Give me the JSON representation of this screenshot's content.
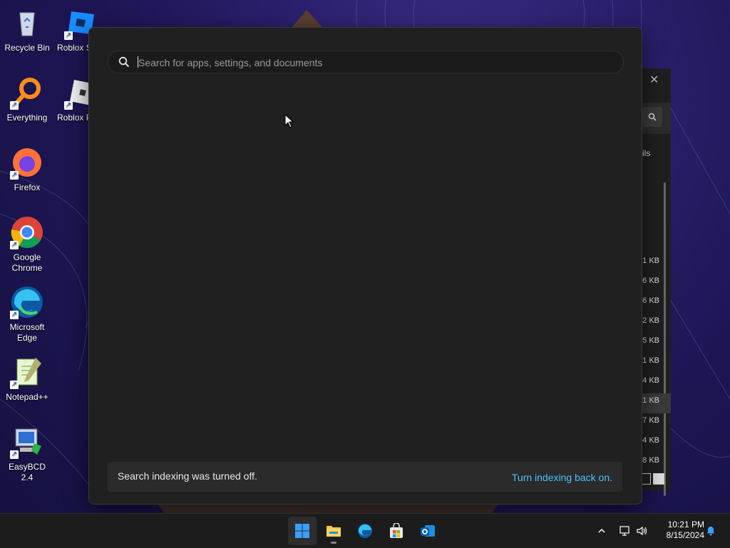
{
  "desktop": {
    "icons": [
      {
        "label": "Recycle Bin"
      },
      {
        "label": "Roblox S"
      },
      {
        "label": "Everything"
      },
      {
        "label": "Roblox P"
      },
      {
        "label": "Firefox"
      },
      {
        "label": "Google Chrome"
      },
      {
        "label": "Microsoft Edge"
      },
      {
        "label": "Notepad++"
      },
      {
        "label": "EasyBCD 2.4"
      }
    ]
  },
  "background_window": {
    "close_glyph": "✕",
    "details_fragment": "tails",
    "sizes": [
      "1 KB",
      "6 KB",
      "6 KB",
      "2 KB",
      "5 KB",
      "1 KB",
      "4 KB",
      "1 KB",
      "7 KB",
      "4 KB",
      "8 KB"
    ]
  },
  "search": {
    "placeholder": "Search for apps, settings, and documents",
    "value": "",
    "notice_text": "Search indexing was turned off.",
    "notice_link": "Turn indexing back on."
  },
  "taskbar": {
    "items": [
      {
        "name": "start-button",
        "icon": "windows-logo-icon"
      },
      {
        "name": "file-explorer",
        "icon": "folder-icon"
      },
      {
        "name": "edge",
        "icon": "edge-icon"
      },
      {
        "name": "microsoft-store",
        "icon": "store-icon"
      },
      {
        "name": "outlook",
        "icon": "outlook-icon"
      }
    ],
    "time": "10:21 PM",
    "date": "8/15/2024"
  },
  "colors": {
    "accent_link": "#4cc2ff",
    "flyout_bg": "#202020",
    "taskbar_bg": "#1c1c1c"
  }
}
